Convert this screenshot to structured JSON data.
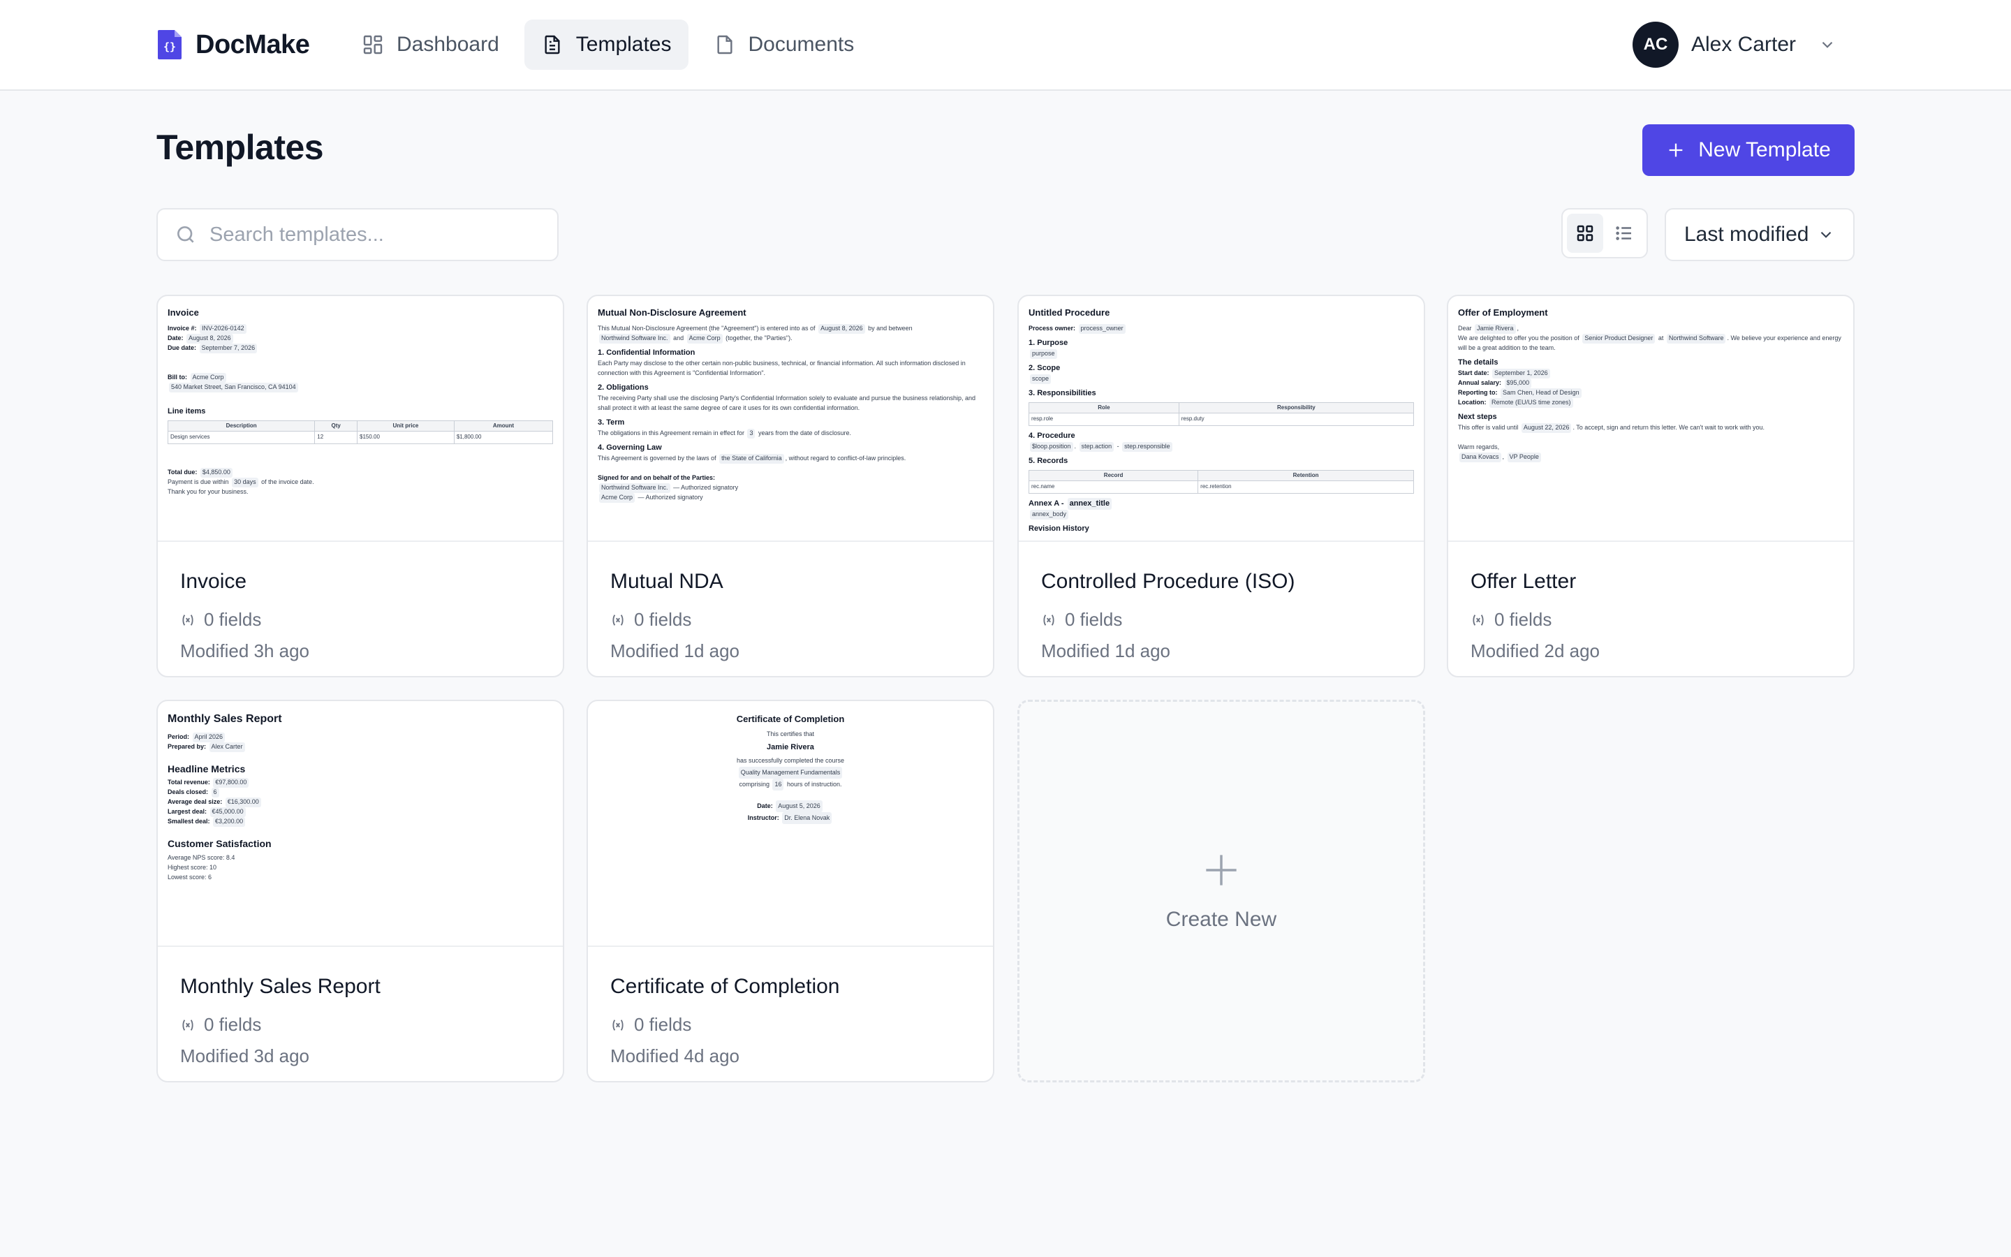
{
  "app": {
    "brand_name": "DocMake",
    "nav": [
      {
        "label": "Dashboard",
        "icon": "dashboard-icon"
      },
      {
        "label": "Templates",
        "icon": "document-icon",
        "active": true
      },
      {
        "label": "Documents",
        "icon": "documents-icon"
      }
    ],
    "user": {
      "initials": "AC",
      "name": "Alex Carter"
    }
  },
  "page": {
    "title": "Templates",
    "new_button_label": "New Template",
    "search_placeholder": "Search templates...",
    "sort_label": "Last modified",
    "view_mode": "grid"
  },
  "templates": [
    {
      "title": "Invoice",
      "fields": "0 fields",
      "modified": "Modified 3h ago"
    },
    {
      "title": "Mutual NDA",
      "fields": "0 fields",
      "modified": "Modified 1d ago"
    },
    {
      "title": "Controlled Procedure (ISO)",
      "fields": "0 fields",
      "modified": "Modified 1d ago"
    },
    {
      "title": "Offer Letter",
      "fields": "0 fields",
      "modified": "Modified 2d ago"
    },
    {
      "title": "Monthly Sales Report",
      "fields": "0 fields",
      "modified": "Modified 3d ago"
    },
    {
      "title": "Certificate of Completion",
      "fields": "0 fields",
      "modified": "Modified 4d ago"
    }
  ],
  "create_new_label": "Create New",
  "previews": {
    "invoice": {
      "title": "Invoice",
      "invoice_no_label": "Invoice #:",
      "invoice_no": "INV-2026-0142",
      "date_label": "Date:",
      "date": "August 8, 2026",
      "due_label": "Due date:",
      "due": "September 7, 2026",
      "bill_to_label": "Bill to:",
      "bill_to": "Acme Corp",
      "address": "540 Market Street, San Francisco, CA 94104",
      "line_items_heading": "Line items",
      "columns": [
        "Description",
        "Qty",
        "Unit price",
        "Amount"
      ],
      "row": [
        "Design services",
        "12",
        "$150.00",
        "$1,800.00"
      ],
      "total_label": "Total due:",
      "total": "$4,850.00",
      "payment_pre": "Payment is due within",
      "payment_days": "30 days",
      "payment_post": "of the invoice date.",
      "thanks": "Thank you for your business."
    },
    "nda": {
      "title": "Mutual Non-Disclosure Agreement",
      "intro_1": "This Mutual Non-Disclosure Agreement (the \"Agreement\") is entered into as of",
      "intro_date": "August 8, 2026",
      "intro_2": "by and between",
      "party_a": "Northwind Software Inc.",
      "intro_3": "and",
      "party_b": "Acme Corp",
      "intro_4": "(together, the \"Parties\").",
      "s1": "1. Confidential Information",
      "s1_text": "Each Party may disclose to the other certain non-public business, technical, or financial information. All such information disclosed in connection with this Agreement is \"Confidential Information\".",
      "s2": "2. Obligations",
      "s2_text": "The receiving Party shall use the disclosing Party's Confidential Information solely to evaluate and pursue the business relationship, and shall protect it with at least the same degree of care it uses for its own confidential information.",
      "s3": "3. Term",
      "s3_pre": "The obligations in this Agreement remain in effect for",
      "s3_years": "3",
      "s3_post": "years from the date of disclosure.",
      "s4": "4. Governing Law",
      "s4_pre": "This Agreement is governed by the laws of",
      "s4_state": "the State of California",
      "s4_post": ", without regard to conflict-of-law principles.",
      "signed": "Signed for and on behalf of the Parties:",
      "sig_a": "Northwind Software Inc.",
      "sig_b": "Acme Corp",
      "sig_suffix": "— Authorized signatory"
    },
    "iso": {
      "title": "Untitled Procedure",
      "owner_label": "Process owner:",
      "owner": "process_owner",
      "h1": "1. Purpose",
      "v1": "purpose",
      "h2": "2. Scope",
      "v2": "scope",
      "h3": "3. Responsibilities",
      "resp_cols": [
        "Role",
        "Responsibility"
      ],
      "resp_row": [
        "resp.role",
        "resp.duty"
      ],
      "h4": "4. Procedure",
      "proc_tags": [
        "$loop.position",
        "step.action",
        "step.responsible"
      ],
      "h5": "5. Records",
      "rec_cols": [
        "Record",
        "Retention"
      ],
      "rec_row": [
        "rec.name",
        "rec.retention"
      ],
      "annex_label": "Annex A -",
      "annex_title": "annex_title",
      "annex_body": "annex_body",
      "revision": "Revision History"
    },
    "offer": {
      "title": "Offer of Employment",
      "dear": "Dear",
      "name": "Jamie Rivera",
      "body_1": "We are delighted to offer you the position of",
      "position": "Senior Product Designer",
      "at": "at",
      "company": "Northwind Software",
      "body_2": ". We believe your experience and energy will be a great addition to the team.",
      "details_heading": "The details",
      "start_label": "Start date:",
      "start": "September 1, 2026",
      "salary_label": "Annual salary:",
      "salary": "$95,000",
      "reporting_label": "Reporting to:",
      "reporting": "Sam Chen, Head of Design",
      "location_label": "Location:",
      "location": "Remote (EU/US time zones)",
      "next_heading": "Next steps",
      "valid_pre": "This offer is valid until",
      "valid_date": "August 22, 2026",
      "valid_post": ". To accept, sign and return this letter. We can't wait to work with you.",
      "regards": "Warm regards,",
      "signer": "Dana Kovacs",
      "signer_title": "VP People"
    },
    "sales": {
      "title": "Monthly Sales Report",
      "period_label": "Period:",
      "period": "April 2026",
      "prepared_label": "Prepared by:",
      "prepared": "Alex Carter",
      "metrics_heading": "Headline Metrics",
      "revenue_label": "Total revenue:",
      "revenue": "€97,800.00",
      "deals_label": "Deals closed:",
      "deals": "6",
      "avg_label": "Average deal size:",
      "avg": "€16,300.00",
      "largest_label": "Largest deal:",
      "largest": "€45,000.00",
      "smallest_label": "Smallest deal:",
      "smallest": "€3,200.00",
      "satisfaction_heading": "Customer Satisfaction",
      "nps": "Average NPS score: 8.4",
      "highest": "Highest score: 10",
      "lowest": "Lowest score: 6"
    },
    "certificate": {
      "title": "Certificate of Completion",
      "certifies": "This certifies that",
      "name": "Jamie Rivera",
      "completed": "has successfully completed the course",
      "course": "Quality Management Fundamentals",
      "comprising_pre": "comprising",
      "hours": "16",
      "comprising_post": "hours of instruction.",
      "date_label": "Date:",
      "date": "August 5, 2026",
      "instructor_label": "Instructor:",
      "instructor": "Dr. Elena Novak"
    }
  },
  "colors": {
    "accent": "#4f46e5",
    "avatar": "#111827",
    "background": "#f8f9fb"
  }
}
